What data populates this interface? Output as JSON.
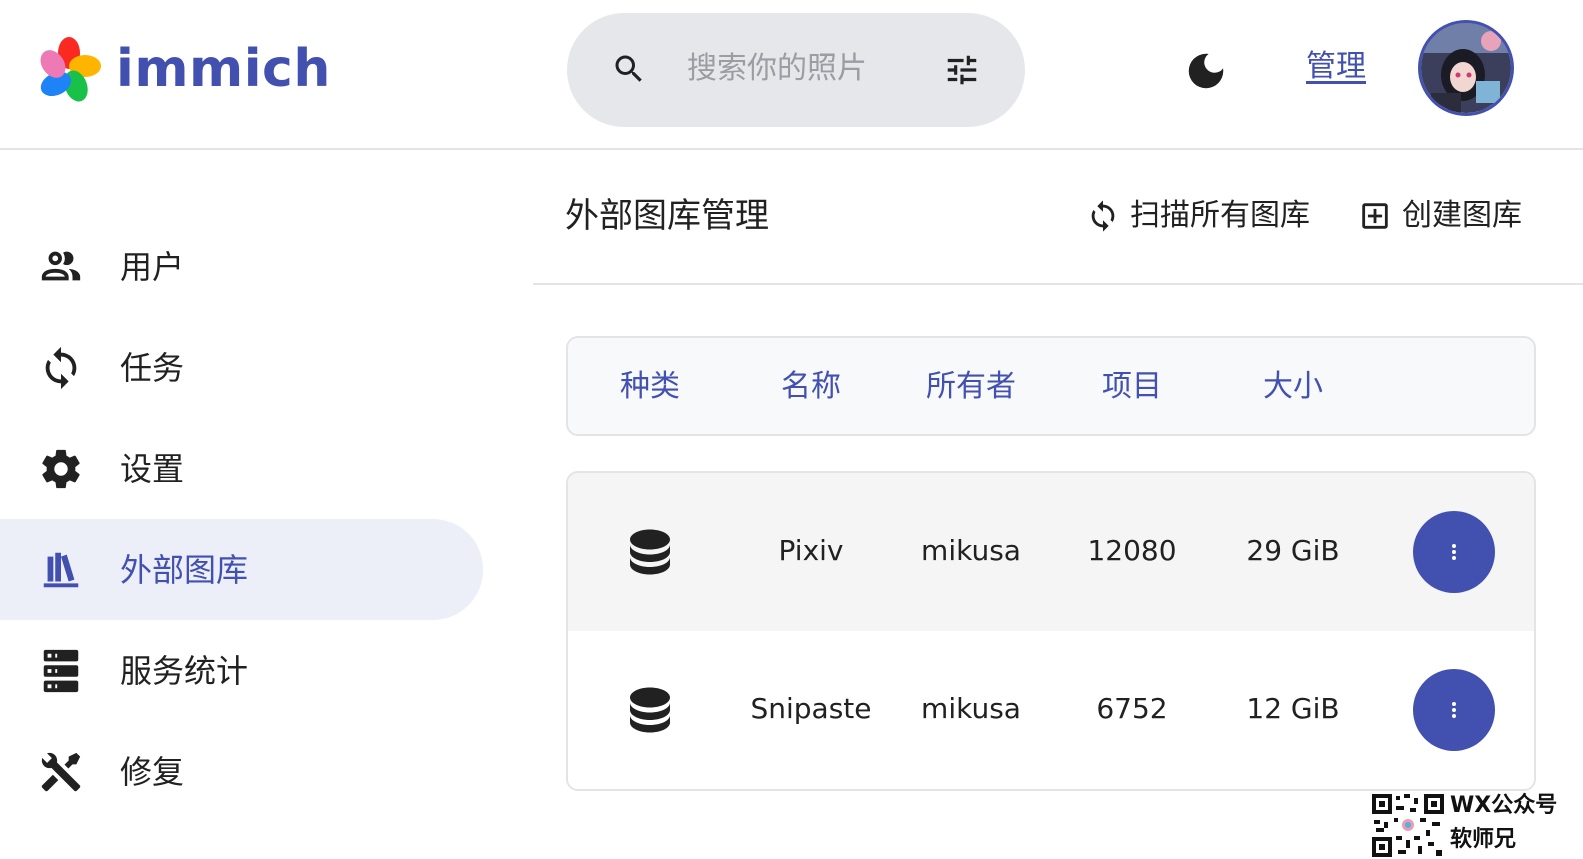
{
  "header": {
    "logo_text": "immich",
    "search_placeholder": "搜索你的照片",
    "admin_link": "管理"
  },
  "sidebar": {
    "items": [
      {
        "label": "用户",
        "icon": "users-icon"
      },
      {
        "label": "任务",
        "icon": "sync-icon"
      },
      {
        "label": "设置",
        "icon": "gear-icon"
      },
      {
        "label": "外部图库",
        "icon": "library-shelves-icon",
        "active": true
      },
      {
        "label": "服务统计",
        "icon": "server-icon"
      },
      {
        "label": "修复",
        "icon": "tools-icon"
      }
    ]
  },
  "main": {
    "title": "外部图库管理",
    "actions": {
      "scan_all": "扫描所有图库",
      "create": "创建图库"
    },
    "table": {
      "columns": [
        "种类",
        "名称",
        "所有者",
        "项目",
        "大小"
      ],
      "rows": [
        {
          "type_icon": "database-icon",
          "name": "Pixiv",
          "owner": "mikusa",
          "items": "12080",
          "size": "29 GiB"
        },
        {
          "type_icon": "database-icon",
          "name": "Snipaste",
          "owner": "mikusa",
          "items": "6752",
          "size": "12 GiB"
        }
      ]
    }
  },
  "watermark": {
    "line1": "WX公众号",
    "line2": "软师兄"
  },
  "colors": {
    "accent": "#4250af",
    "active_bg": "#eceef8",
    "search_bg": "#e5e7eb"
  }
}
